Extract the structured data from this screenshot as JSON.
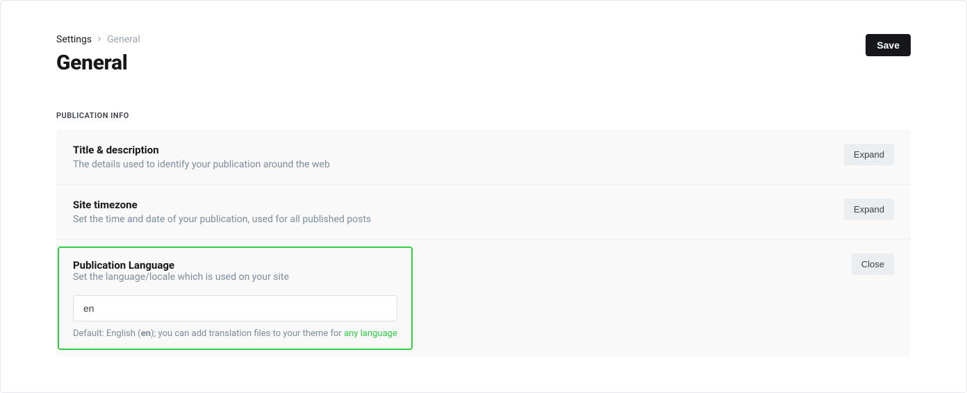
{
  "breadcrumb": {
    "root": "Settings",
    "current": "General"
  },
  "page_title": "General",
  "save_label": "Save",
  "section_label": "PUBLICATION INFO",
  "rows": {
    "title_desc": {
      "title": "Title & description",
      "desc": "The details used to identify your publication around the web",
      "action": "Expand"
    },
    "timezone": {
      "title": "Site timezone",
      "desc": "Set the time and date of your publication, used for all published posts",
      "action": "Expand"
    },
    "language": {
      "title": "Publication Language",
      "desc": "Set the language/locale which is used on your site",
      "action": "Close",
      "input_value": "en",
      "hint_prefix": "Default: English (",
      "hint_bold": "en",
      "hint_mid": "); you can add translation files to your theme for ",
      "hint_link": "any language"
    }
  }
}
